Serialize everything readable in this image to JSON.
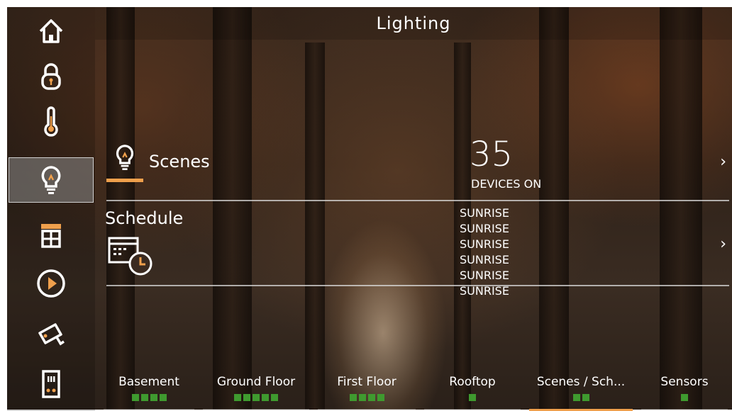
{
  "header": {
    "title": "Lighting"
  },
  "sidebar": {
    "items": [
      {
        "icon": "home-icon",
        "active": false
      },
      {
        "icon": "lock-icon",
        "active": false
      },
      {
        "icon": "thermometer-icon",
        "active": false
      },
      {
        "icon": "lightbulb-icon",
        "active": true
      },
      {
        "icon": "window-shade-icon",
        "active": false
      },
      {
        "icon": "play-icon",
        "active": false
      },
      {
        "icon": "camera-icon",
        "active": false
      },
      {
        "icon": "intercom-icon",
        "active": false
      }
    ]
  },
  "scenes": {
    "label": "Scenes",
    "devices_count": "35",
    "devices_label": "DEVICES ON",
    "chevron": "›"
  },
  "schedule": {
    "label": "Schedule",
    "items": [
      "SUNRISE",
      "SUNRISE",
      "SUNRISE",
      "SUNRISE",
      "SUNRISE",
      "SUNRISE"
    ],
    "chevron": "›"
  },
  "tabs": [
    {
      "label": "Basement",
      "dots": 4
    },
    {
      "label": "Ground Floor",
      "dots": 5
    },
    {
      "label": "First Floor",
      "dots": 4
    },
    {
      "label": "Rooftop",
      "dots": 1
    },
    {
      "label": "Scenes / Sch...",
      "dots": 2,
      "active": true
    },
    {
      "label": "Sensors",
      "dots": 1
    }
  ],
  "colors": {
    "accent": "#f0a04c",
    "indicator": "#3f9a2f"
  }
}
